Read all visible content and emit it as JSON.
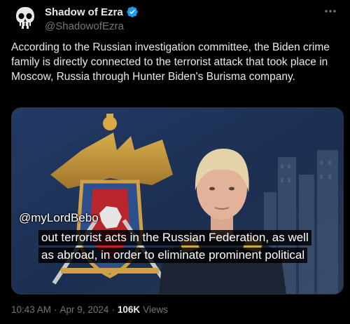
{
  "author": {
    "display_name": "Shadow of Ezra",
    "handle": "@ShadowofEzra",
    "avatar_icon": "skull-icon",
    "verified_color": "#1d9bf0"
  },
  "more_icon": "more-horizontal-icon",
  "tweet_text": "According to the Russian investigation committee, the Biden crime family is directly connected to the terrorist attack that took place in Moscow, Russia through Hunter Biden's Burisma company.",
  "media": {
    "watermark": "@myLordBebo",
    "subtitle_line1": "out terrorist acts in the Russian Federation, as well",
    "subtitle_line2": "as abroad, in order to eliminate prominent political"
  },
  "meta": {
    "time": "10:43 AM",
    "separator": "·",
    "date": "Apr 9, 2024",
    "separator2": "·",
    "views_count": "106K",
    "views_label": "Views"
  },
  "colors": {
    "background": "#000000",
    "text": "#e7e9ea",
    "muted": "#71767b",
    "accent": "#1d9bf0"
  }
}
